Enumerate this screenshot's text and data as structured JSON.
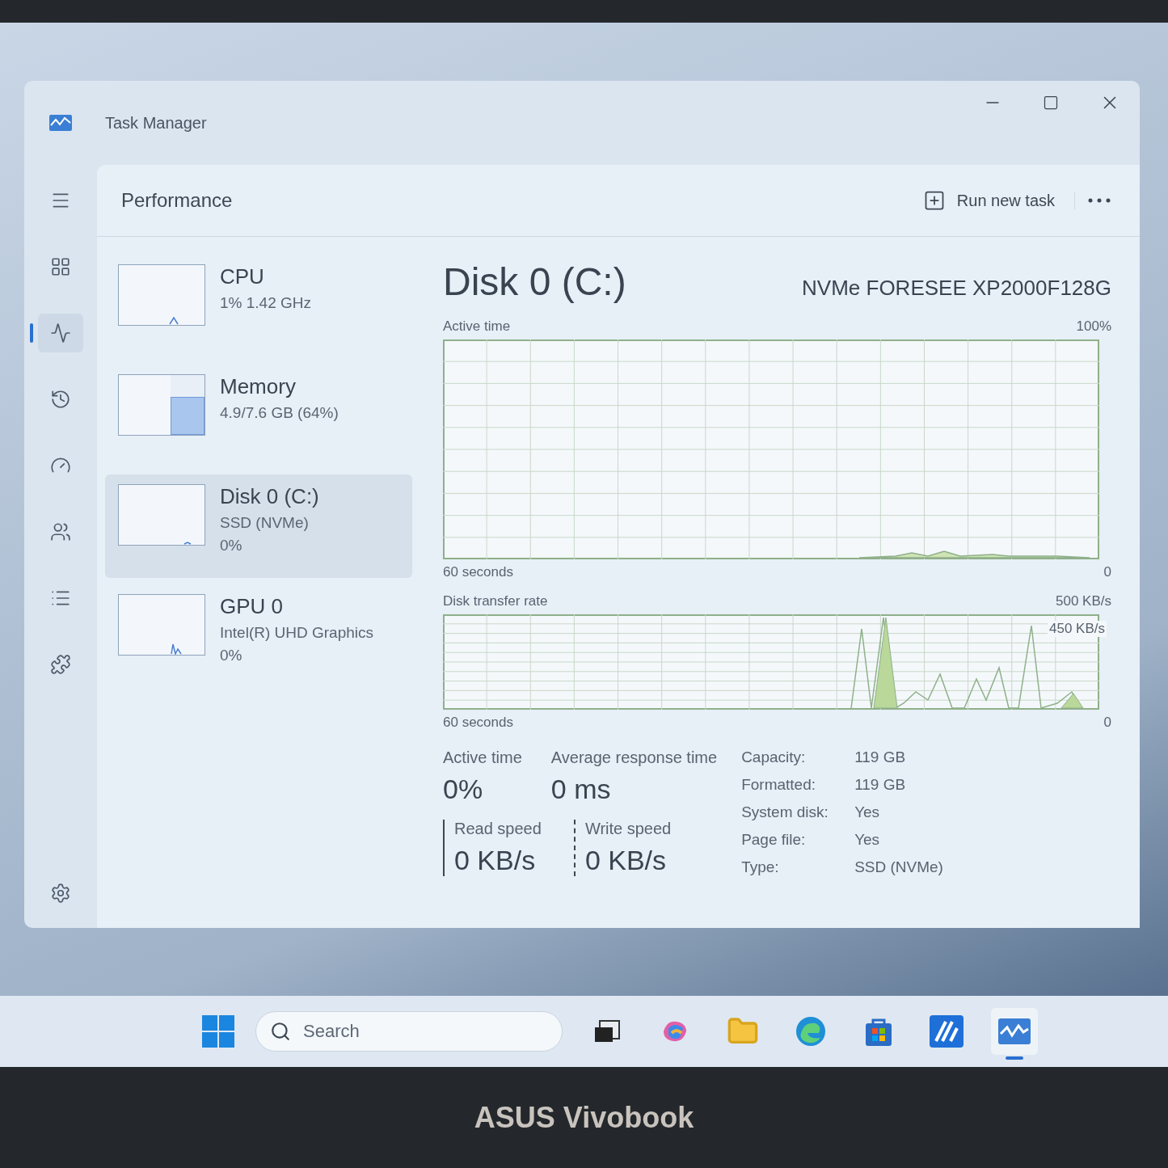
{
  "window": {
    "title": "Task Manager"
  },
  "sidebar": {
    "items": [
      {
        "kind": "menu",
        "selected": false
      },
      {
        "kind": "processes",
        "selected": false
      },
      {
        "kind": "performance",
        "selected": true
      },
      {
        "kind": "history",
        "selected": false
      },
      {
        "kind": "startup",
        "selected": false
      },
      {
        "kind": "users",
        "selected": false
      },
      {
        "kind": "details",
        "selected": false
      },
      {
        "kind": "services",
        "selected": false
      }
    ]
  },
  "header": {
    "title": "Performance",
    "action": "Run new task"
  },
  "devices": [
    {
      "kind": "cpu",
      "name": "CPU",
      "lines": [
        "1%  1.42 GHz"
      ],
      "selected": false
    },
    {
      "kind": "memory",
      "name": "Memory",
      "lines": [
        "4.9/7.6 GB (64%)"
      ],
      "selected": false,
      "level": 0.64
    },
    {
      "kind": "disk",
      "name": "Disk 0 (C:)",
      "lines": [
        "SSD (NVMe)",
        "0%"
      ],
      "selected": true
    },
    {
      "kind": "gpu",
      "name": "GPU 0",
      "lines": [
        "Intel(R) UHD Graphics",
        "0%"
      ],
      "selected": false
    }
  ],
  "detail": {
    "title": "Disk 0 (C:)",
    "model": "NVMe FORESEE XP2000F128G",
    "active_chart": {
      "label": "Active time",
      "max": "100%",
      "span": "60 seconds",
      "min": "0"
    },
    "transfer_chart": {
      "label": "Disk transfer rate",
      "max": "500 KB/s",
      "marker": "450 KB/s",
      "span": "60 seconds",
      "min": "0"
    },
    "stats": [
      {
        "label": "Active time",
        "value": "0%"
      },
      {
        "label": "Average response time",
        "value": "0 ms"
      }
    ],
    "speeds": [
      {
        "kind": "read",
        "label": "Read speed",
        "value": "0 KB/s"
      },
      {
        "kind": "write",
        "label": "Write speed",
        "value": "0 KB/s"
      }
    ],
    "properties": [
      {
        "label": "Capacity:",
        "value": "119 GB"
      },
      {
        "label": "Formatted:",
        "value": "119 GB"
      },
      {
        "label": "System disk:",
        "value": "Yes"
      },
      {
        "label": "Page file:",
        "value": "Yes"
      },
      {
        "label": "Type:",
        "value": "SSD (NVMe)"
      }
    ]
  },
  "taskbar": {
    "search_placeholder": "Search",
    "apps": [
      {
        "kind": "taskview",
        "running": false
      },
      {
        "kind": "copilot",
        "running": false
      },
      {
        "kind": "files",
        "running": false
      },
      {
        "kind": "browser",
        "running": false
      },
      {
        "kind": "store",
        "running": false
      },
      {
        "kind": "editor",
        "running": false
      },
      {
        "kind": "taskmanager",
        "running": true
      }
    ]
  },
  "device_brand": "ASUS Vivobook"
}
